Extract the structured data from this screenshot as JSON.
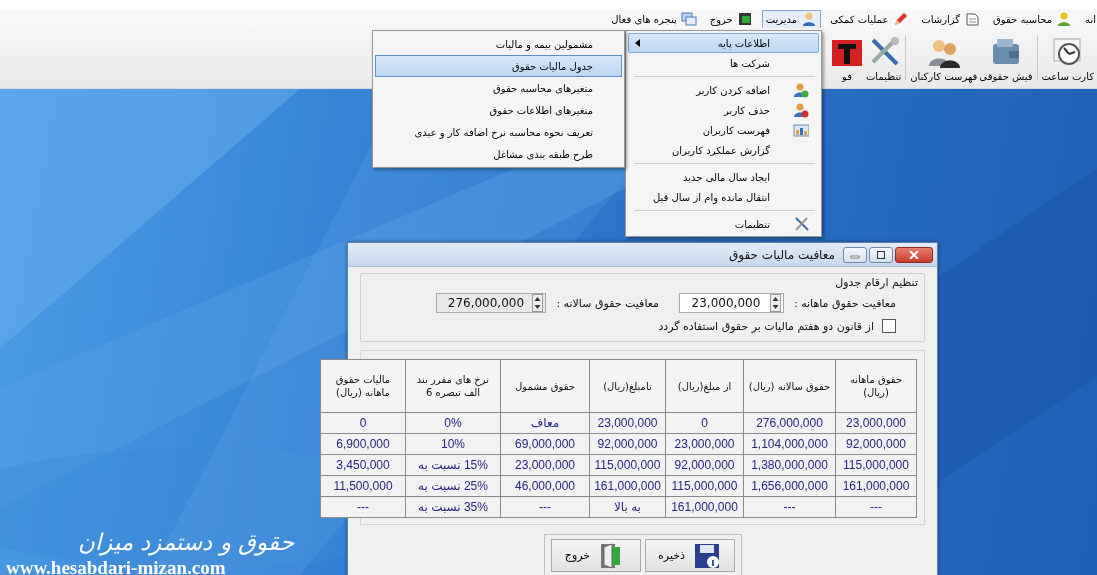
{
  "menu_bar": {
    "items": [
      {
        "label": "انه",
        "selected": false
      },
      {
        "label": "محاسبه حقوق",
        "selected": false
      },
      {
        "label": "گزارشات",
        "selected": false
      },
      {
        "label": "عملیات کمکی",
        "selected": false
      },
      {
        "label": "مدیریت",
        "selected": true
      },
      {
        "label": "خروج",
        "selected": false
      },
      {
        "label": "پنجره های فعال",
        "selected": false
      }
    ]
  },
  "toolbar": {
    "items": [
      {
        "kind": "button",
        "label": "کارت ساعت"
      },
      {
        "kind": "separator"
      },
      {
        "kind": "button",
        "label": "فیش حقوقی"
      },
      {
        "kind": "button",
        "label": "فهرست کارکنان"
      },
      {
        "kind": "separator"
      },
      {
        "kind": "button",
        "label": "تنظیمات"
      },
      {
        "kind": "button",
        "label": "فو"
      }
    ]
  },
  "menu": {
    "items": [
      {
        "kind": "item",
        "label": "اطلاعات پایه",
        "selected": true,
        "has_submenu": true
      },
      {
        "kind": "item",
        "label": "شرکت ها",
        "selected": false,
        "has_submenu": false
      },
      {
        "kind": "separator"
      },
      {
        "kind": "item",
        "label": "اضافه کردن کاربر",
        "selected": false,
        "has_submenu": false
      },
      {
        "kind": "item",
        "label": "حذف کاربر",
        "selected": false,
        "has_submenu": false
      },
      {
        "kind": "item",
        "label": "فهرست کاربران",
        "selected": false,
        "has_submenu": false
      },
      {
        "kind": "item",
        "label": "گزارش عملکرد کاربران",
        "selected": false,
        "has_submenu": false
      },
      {
        "kind": "separator"
      },
      {
        "kind": "item",
        "label": "ایجاد سال مالی جدید",
        "selected": false,
        "has_submenu": false
      },
      {
        "kind": "item",
        "label": "انتقال مانده وام از سال قبل",
        "selected": false,
        "has_submenu": false
      },
      {
        "kind": "separator"
      },
      {
        "kind": "item",
        "label": "تنظیمات",
        "selected": false,
        "has_submenu": false
      }
    ]
  },
  "submenu": {
    "items": [
      {
        "label": "مشمولین بیمه و مالیات",
        "selected": false
      },
      {
        "label": "جدول مالیات حقوق",
        "selected": true
      },
      {
        "label": "متغیرهای محاسبه حقوق",
        "selected": false
      },
      {
        "label": "متغیرهای اطلاعات حقوق",
        "selected": false
      },
      {
        "label": "تعریف نحوه محاسبه نرخ اضافه کار و عیدی",
        "selected": false
      },
      {
        "label": "طرح طبقه بندی مشاغل",
        "selected": false
      }
    ]
  },
  "background": {
    "title": "حقوق و دستمزد میزان",
    "url": "www.hesabdari-mizan.com"
  },
  "dialog": {
    "title": "معافیت مالیات حقوق",
    "group": {
      "title": "تنظیم ارقام جدول",
      "monthly": {
        "label": "معافیت حقوق ماهانه :",
        "value": "23,000,000",
        "disabled": false
      },
      "annual": {
        "label": "معافیت حقوق سالانه :",
        "value": "276,000,000",
        "disabled": true
      },
      "checkbox": {
        "label": "از قانون دو هفتم مالیات بر حقوق استفاده گردد",
        "checked": false
      }
    },
    "table": {
      "columns": [
        "حقوق ماهانه (ریال)",
        "حقوق سالانه (ریال)",
        "از مبلغ(ریال)",
        "تامبلغ(ریال)",
        "حقوق مشمول",
        "نرخ های مقرر بند الف تبصره 6",
        "مالیات حقوق ماهانه (ریال)"
      ],
      "rows": [
        [
          "23,000,000",
          "276,000,000",
          "0",
          "23,000,000",
          "معاف",
          "0%",
          "0"
        ],
        [
          "92,000,000",
          "1,104,000,000",
          "23,000,000",
          "92,000,000",
          "69,000,000",
          "10%",
          "6,900,000"
        ],
        [
          "115,000,000",
          "1,380,000,000",
          "92,000,000",
          "115,000,000",
          "23,000,000",
          "15% نسبت به",
          "3,450,000"
        ],
        [
          "161,000,000",
          "1,656,000,000",
          "115,000,000",
          "161,000,000",
          "46,000,000",
          "25% نسبت به",
          "11,500,000"
        ],
        [
          "---",
          "---",
          "161,000,000",
          "به بالا",
          "---",
          "35% نسبت به",
          "---"
        ]
      ]
    },
    "buttons": [
      {
        "kind": "save",
        "label": "ذخیره"
      },
      {
        "kind": "exit",
        "label": "خروج"
      }
    ]
  }
}
